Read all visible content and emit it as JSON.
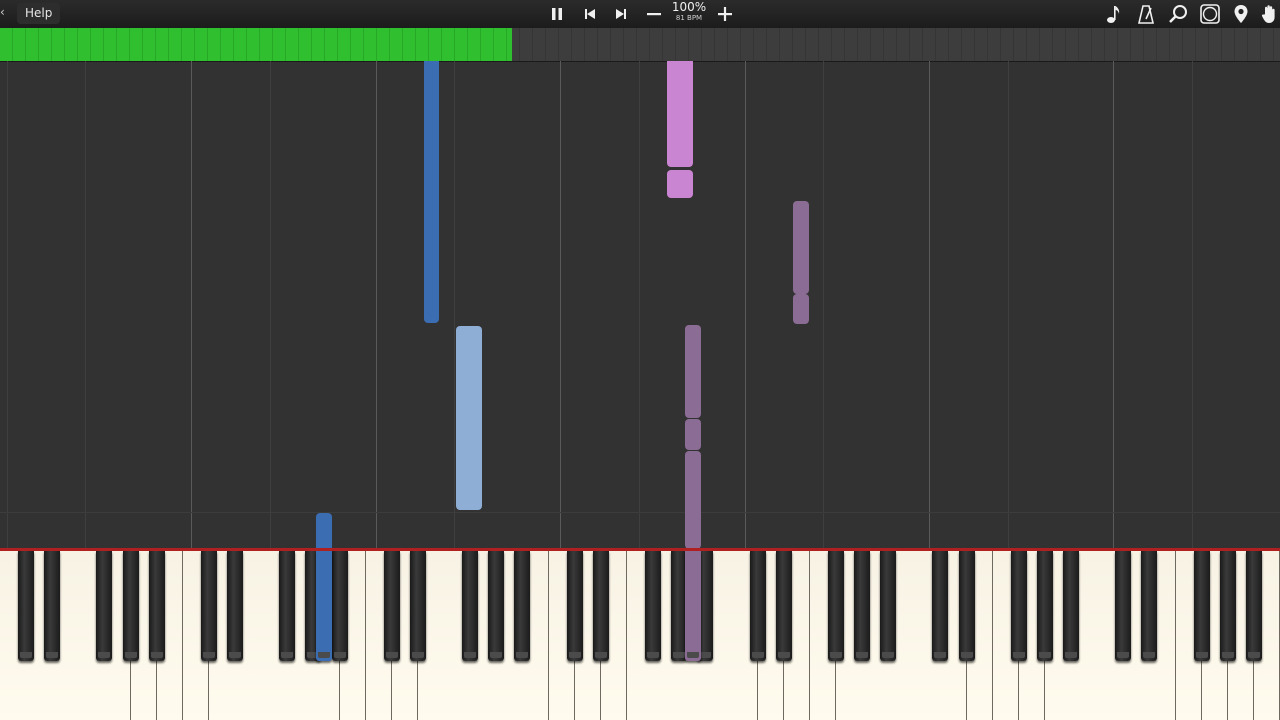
{
  "toolbar": {
    "help_label": "Help",
    "back_glyph": "‹",
    "pause_icon": "pause-icon",
    "prev_icon": "skip-back-icon",
    "next_icon": "skip-forward-icon",
    "speed_minus_icon": "minus-icon",
    "speed_plus_icon": "plus-icon",
    "speed_percent": "100%",
    "speed_bpm": "81 BPM",
    "right_icons": [
      "note-icon",
      "metronome-icon",
      "magnifier-icon",
      "la-label-icon",
      "location-pin-icon",
      "hand-icon"
    ]
  },
  "progress": {
    "fraction": 0.4,
    "fill_color": "#2fbf2f"
  },
  "colors": {
    "background": "#323232",
    "blue_note": "#3b6db3",
    "light_blue_note": "#8eaed6",
    "pink_note": "#c985d2",
    "purple_note": "#8b6c94",
    "keyboard_edge": "#b02020"
  },
  "notes": [
    {
      "key": "blue_note",
      "pitch_index": 14
    },
    {
      "key": "light_blue_note",
      "pitch_index": 15
    },
    {
      "key": "blue_note",
      "pitch_index": 10
    },
    {
      "key": "pink_note",
      "pitch_index": 22
    },
    {
      "key": "pink_note",
      "pitch_index": 22
    },
    {
      "key": "purple_note",
      "pitch_index": 26
    },
    {
      "key": "purple_note",
      "pitch_index": 26
    },
    {
      "key": "purple_note",
      "pitch_index": 23
    },
    {
      "key": "purple_note",
      "pitch_index": 23
    },
    {
      "key": "purple_note",
      "pitch_index": 23
    }
  ]
}
